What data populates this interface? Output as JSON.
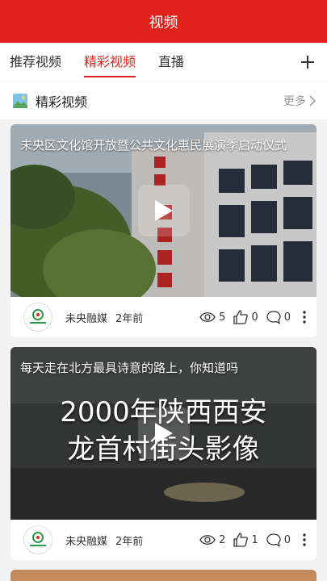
{
  "header": {
    "title": "视频"
  },
  "tabs": [
    {
      "label": "推荐视频"
    },
    {
      "label": "精彩视频"
    },
    {
      "label": "直播"
    }
  ],
  "section": {
    "title": "精彩视频",
    "more_label": "更多"
  },
  "videos": [
    {
      "title": "未央区文化馆开放暨公共文化惠民展演季启动仪式",
      "source": "未央融媒",
      "time_ago": "2年前",
      "views": "5",
      "likes": "0",
      "comments": "0"
    },
    {
      "title": "每天走在北方最具诗意的路上，你知道吗",
      "thumb_caption_line1": "2000年陕西西安",
      "thumb_caption_line2": "龙首村街头影像",
      "source": "未央融媒",
      "time_ago": "2年前",
      "views": "2",
      "likes": "1",
      "comments": "0"
    }
  ],
  "colors": {
    "brand": "#e1211b"
  }
}
